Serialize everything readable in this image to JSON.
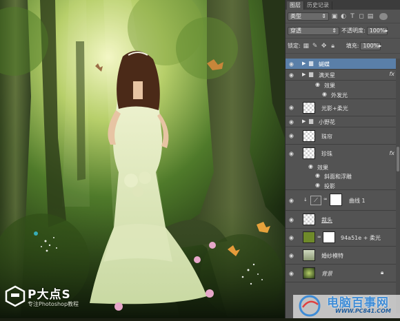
{
  "panel": {
    "tabs": [
      "图层",
      "历史记录"
    ],
    "filter": {
      "value": "类型"
    },
    "blend_mode": "穿透",
    "opacity_label": "不透明度:",
    "opacity_value": "100%",
    "lock_label": "锁定:",
    "fill_label": "填充:",
    "fill_value": "100%"
  },
  "layers": [
    {
      "name": "蝴蝶",
      "kind": "group",
      "selected": true
    },
    {
      "name": "满天星",
      "kind": "group",
      "fx": "fx"
    },
    {
      "name": "效果",
      "kind": "effect-header",
      "indent": 1
    },
    {
      "name": "外发光",
      "kind": "effect",
      "indent": 2
    },
    {
      "name": "光影+柔光",
      "kind": "layer"
    },
    {
      "name": "小野花",
      "kind": "group"
    },
    {
      "name": "珠帘",
      "kind": "layer"
    },
    {
      "name": "珍珠",
      "kind": "layer",
      "fx": "fx"
    },
    {
      "name": "效果",
      "kind": "effect-header",
      "indent": 1
    },
    {
      "name": "斜面和浮雕",
      "kind": "effect",
      "indent": 2
    },
    {
      "name": "投影",
      "kind": "effect",
      "indent": 2
    },
    {
      "name": "曲线 1",
      "kind": "adjustment"
    },
    {
      "name": "裁头",
      "kind": "layer"
    },
    {
      "name": "94a51e + 柔光",
      "kind": "fill-mask"
    },
    {
      "name": "婚纱模特",
      "kind": "photo"
    },
    {
      "name": "背景",
      "kind": "background",
      "locked": true
    }
  ],
  "watermark_left": {
    "title": "P大点S",
    "subtitle": "专注Photoshop教程"
  },
  "watermark_right": {
    "title": "电脑百事网",
    "url": "WWW.PC841.COM"
  },
  "colors": {
    "panel": "#535353",
    "selected": "#5a7fa8",
    "accent_blue": "#3e8cd6"
  }
}
